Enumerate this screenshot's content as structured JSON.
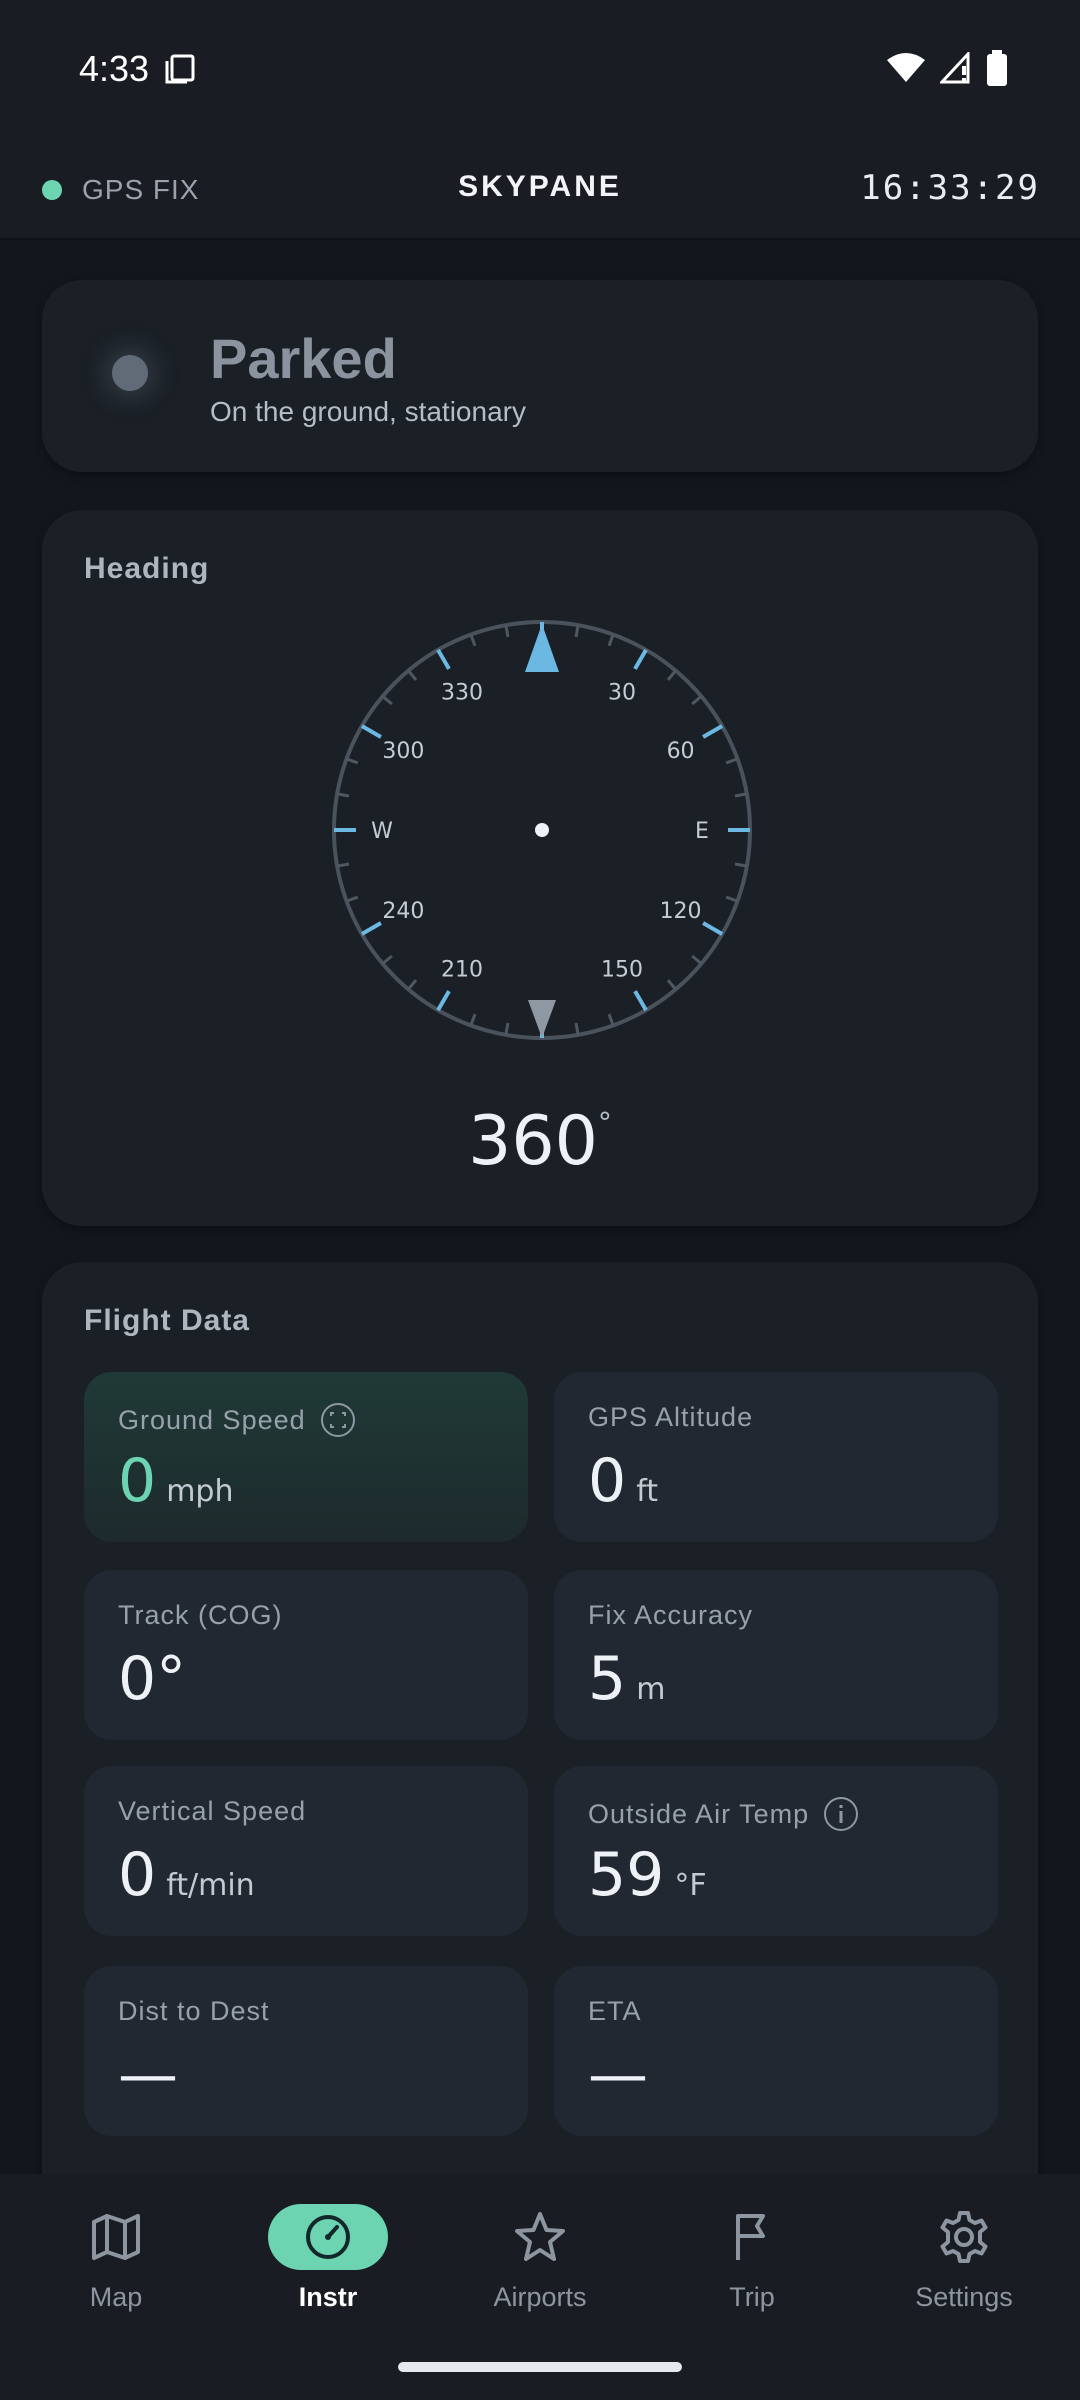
{
  "status_bar": {
    "time": "4:33"
  },
  "header": {
    "gps_label": "GPS FIX",
    "title": "SKYPANE",
    "clock": "16:33:29"
  },
  "status_card": {
    "title": "Parked",
    "subtitle": "On the ground, stationary"
  },
  "heading": {
    "label": "Heading",
    "value": "360",
    "degree": "°",
    "compass_labels": [
      "330",
      "30",
      "300",
      "60",
      "W",
      "E",
      "240",
      "120",
      "210",
      "150"
    ]
  },
  "flight_data": {
    "label": "Flight Data",
    "tiles": [
      {
        "label": "Ground Speed",
        "value": "0",
        "unit": "mph"
      },
      {
        "label": "GPS Altitude",
        "value": "0",
        "unit": "ft"
      },
      {
        "label": "Track (COG)",
        "value": "0°",
        "unit": ""
      },
      {
        "label": "Fix Accuracy",
        "value": "5",
        "unit": "m"
      },
      {
        "label": "Vertical Speed",
        "value": "0",
        "unit": "ft/min"
      },
      {
        "label": "Outside Air Temp",
        "value": "59",
        "unit": "°F"
      },
      {
        "label": "Dist to Dest",
        "value": "—",
        "unit": ""
      },
      {
        "label": "ETA",
        "value": "—",
        "unit": ""
      }
    ]
  },
  "nav": {
    "items": [
      {
        "label": "Map",
        "icon": "map-icon"
      },
      {
        "label": "Instr",
        "icon": "gauge-icon"
      },
      {
        "label": "Airports",
        "icon": "star-icon"
      },
      {
        "label": "Trip",
        "icon": "flag-icon"
      },
      {
        "label": "Settings",
        "icon": "gear-icon"
      }
    ]
  },
  "colors": {
    "accent": "#6cd4b0",
    "compass_tick": "#6bb8e3",
    "background": "#13171d",
    "card": "#1b2027"
  }
}
